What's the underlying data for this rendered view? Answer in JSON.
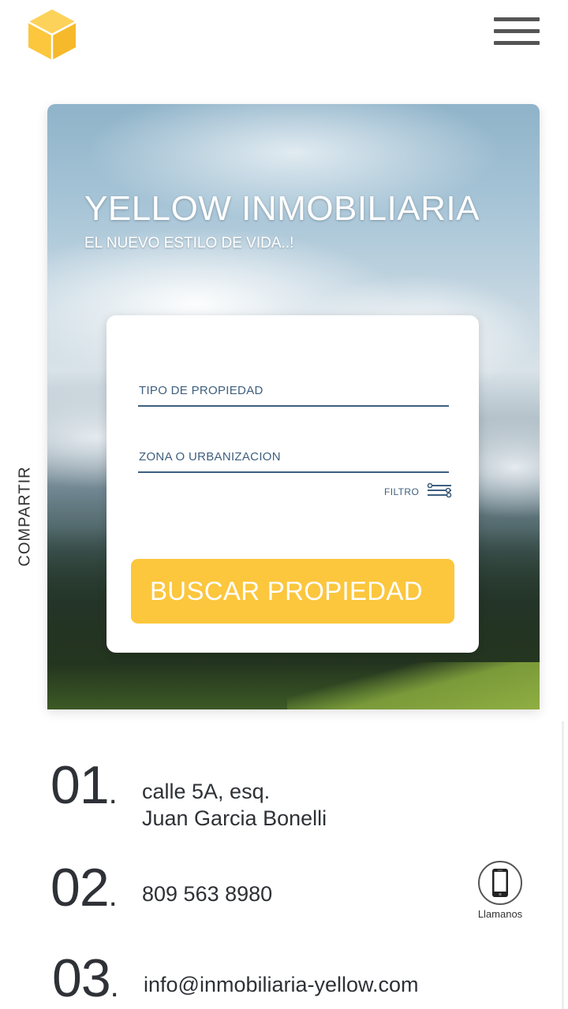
{
  "header": {
    "logo_icon": "cube-icon",
    "menu_icon": "hamburger-menu-icon"
  },
  "hero": {
    "title": "YELLOW INMOBILIARIA",
    "subtitle": "EL NUEVO ESTILO DE VIDA..!"
  },
  "search": {
    "property_type_placeholder": "TIPO DE PROPIEDAD",
    "zone_placeholder": "ZONA O URBANIZACION",
    "filter_label": "FILTRO",
    "filter_icon": "sliders-icon",
    "submit_label": "BUSCAR PROPIEDAD"
  },
  "share_label": "COMPARTIR",
  "contact": [
    {
      "num": "01",
      "line1": "calle 5A, esq.",
      "line2": "Juan Garcia Bonelli"
    },
    {
      "num": "02",
      "line1": "809 563 8980"
    },
    {
      "num": "03",
      "line1": "info@inmobiliaria-yellow.com"
    }
  ],
  "call": {
    "icon": "phone-icon",
    "label": "Llamanos"
  },
  "colors": {
    "accent": "#fcc63d",
    "field_text": "#3e5f7e"
  }
}
